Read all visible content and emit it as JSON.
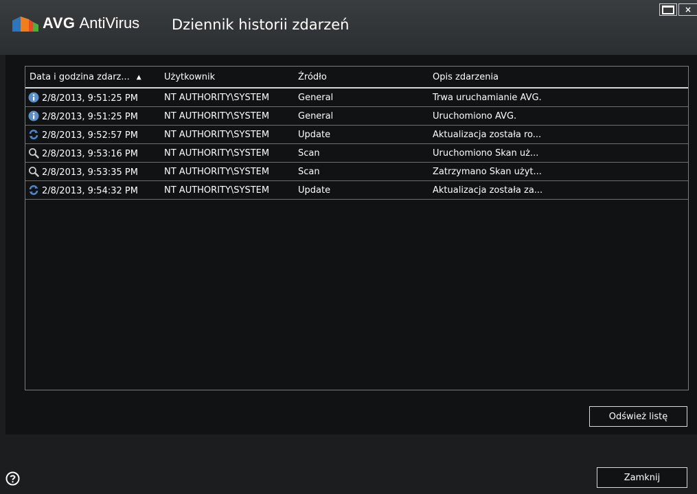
{
  "window": {
    "brand_bold": "AVG",
    "brand_rest": "AntiVirus",
    "dialog_title": "Dziennik historii zdarzeń",
    "close_glyph": "×"
  },
  "table": {
    "columns": [
      "Data i godzina zdarz...",
      "Użytkownik",
      "Źródło",
      "Opis zdarzenia"
    ],
    "sort_indicator": "▲",
    "sort_column": "Data i godzina zdarz...",
    "rows": [
      {
        "icon": "info-icon",
        "datetime": "2/8/2013, 9:51:25 PM",
        "user": "NT AUTHORITY\\SYSTEM",
        "source": "General",
        "description": "Trwa uruchamianie AVG."
      },
      {
        "icon": "info-icon",
        "datetime": "2/8/2013, 9:51:25 PM",
        "user": "NT AUTHORITY\\SYSTEM",
        "source": "General",
        "description": "Uruchomiono AVG."
      },
      {
        "icon": "update-icon",
        "datetime": "2/8/2013, 9:52:57 PM",
        "user": "NT AUTHORITY\\SYSTEM",
        "source": "Update",
        "description": "Aktualizacja została ro..."
      },
      {
        "icon": "scan-icon",
        "datetime": "2/8/2013, 9:53:16 PM",
        "user": "NT AUTHORITY\\SYSTEM",
        "source": "Scan",
        "description": "Uruchomiono Skan uż..."
      },
      {
        "icon": "scan-icon",
        "datetime": "2/8/2013, 9:53:35 PM",
        "user": "NT AUTHORITY\\SYSTEM",
        "source": "Scan",
        "description": "Zatrzymano Skan użyt..."
      },
      {
        "icon": "update-icon",
        "datetime": "2/8/2013, 9:54:32 PM",
        "user": "NT AUTHORITY\\SYSTEM",
        "source": "Update",
        "description": "Aktualizacja została za..."
      }
    ]
  },
  "buttons": {
    "refresh": "Odśwież listę",
    "close": "Zamknij"
  },
  "colors": {
    "background": "#1b1d1f",
    "panel": "#111214",
    "info_icon": "#5b8fc9",
    "update_icon": "#4a86c8",
    "logo_orange": "#f07e1b",
    "logo_green": "#4fae3c",
    "logo_blue": "#1f6cb4"
  }
}
